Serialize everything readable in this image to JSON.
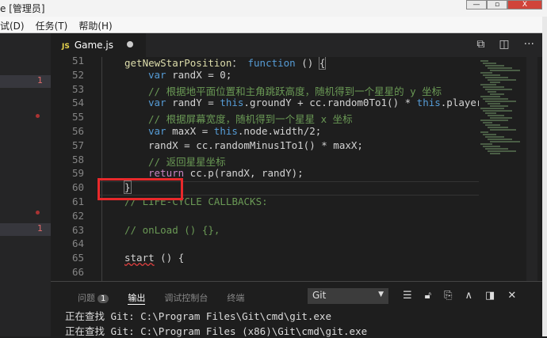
{
  "window": {
    "title": "e [管理员]",
    "controls": [
      "—",
      "▫",
      "X"
    ]
  },
  "menu": [
    "试(D)",
    "任务(T)",
    "帮助(H)"
  ],
  "sidebar": {
    "badges": [
      "1",
      "1"
    ]
  },
  "tab": {
    "name": "Game.js",
    "icon": "JS"
  },
  "editor": {
    "lines": [
      {
        "n": "51",
        "parts": [
          [
            "fn",
            "getNewStarPosition"
          ],
          [
            "",
            "： "
          ],
          [
            "kw",
            "function"
          ],
          [
            "",
            " () "
          ],
          [
            "cur",
            "{"
          ]
        ],
        "indent": 0
      },
      {
        "n": "52",
        "parts": [
          [
            "kw",
            "var"
          ],
          [
            "",
            " randX = 0;"
          ]
        ],
        "indent": 1
      },
      {
        "n": "53",
        "parts": [
          [
            "cm",
            "// 根据地平面位置和主角跳跃高度，随机得到一个星星的 y 坐标"
          ]
        ],
        "indent": 1
      },
      {
        "n": "54",
        "parts": [
          [
            "kw",
            "var"
          ],
          [
            "",
            " randY = "
          ],
          [
            "kw",
            "this"
          ],
          [
            "",
            ".groundY + cc.random0To1() * "
          ],
          [
            "kw",
            "this"
          ],
          [
            "",
            ".player.gr"
          ]
        ],
        "indent": 1
      },
      {
        "n": "55",
        "parts": [
          [
            "cm",
            "// 根据屏幕宽度，随机得到一个星星 x 坐标"
          ]
        ],
        "indent": 1
      },
      {
        "n": "56",
        "parts": [
          [
            "kw",
            "var"
          ],
          [
            "",
            " maxX = "
          ],
          [
            "kw",
            "this"
          ],
          [
            "",
            ".node.width/2;"
          ]
        ],
        "indent": 1
      },
      {
        "n": "57",
        "parts": [
          [
            "",
            "randX = cc.randomMinus1To1() * maxX;"
          ]
        ],
        "indent": 1
      },
      {
        "n": "58",
        "parts": [
          [
            "cm",
            "// 返回星星坐标"
          ]
        ],
        "indent": 1
      },
      {
        "n": "59",
        "parts": [
          [
            "rt",
            "return"
          ],
          [
            "",
            " cc.p(randX, randY);"
          ]
        ],
        "indent": 1
      },
      {
        "n": "60",
        "parts": [
          [
            "cur",
            "}"
          ]
        ],
        "indent": 0
      },
      {
        "n": "61",
        "parts": [
          [
            "cm",
            "// LIFE-CYCLE CALLBACKS:"
          ]
        ],
        "indent": 0
      },
      {
        "n": "62",
        "parts": [],
        "indent": 0
      },
      {
        "n": "63",
        "parts": [
          [
            "cm",
            "// onLoad () {},"
          ]
        ],
        "indent": 0
      },
      {
        "n": "64",
        "parts": [],
        "indent": 0
      },
      {
        "n": "65",
        "parts": [
          [
            "squig",
            "start"
          ],
          [
            "",
            " () {"
          ]
        ],
        "indent": 0
      },
      {
        "n": "66",
        "parts": [],
        "indent": 0
      }
    ]
  },
  "panel": {
    "tabs": [
      {
        "label": "问题",
        "badge": "1"
      },
      {
        "label": "输出",
        "active": true
      },
      {
        "label": "调试控制台"
      },
      {
        "label": "终端"
      }
    ],
    "channel": "Git",
    "output": [
      "正在查找 Git: C:\\Program Files\\Git\\cmd\\git.exe",
      "正在查找 Git: C:\\Program Files (x86)\\Git\\cmd\\git.exe"
    ]
  },
  "colors": {
    "highlight_box": "#e8292b",
    "keyword": "#569cd6",
    "comment": "#6a9955"
  }
}
